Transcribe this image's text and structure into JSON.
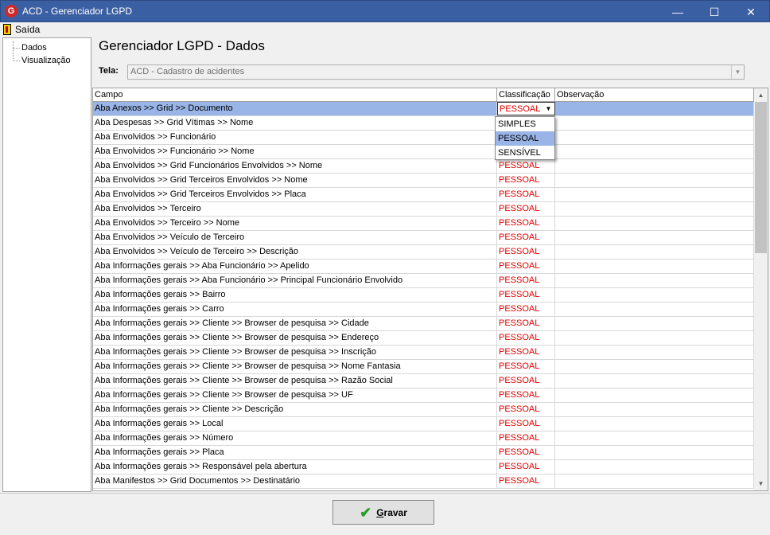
{
  "window": {
    "title": "ACD - Gerenciador LGPD",
    "app_icon_letter": "G",
    "minimize_glyph": "—",
    "maximize_glyph": "☐",
    "close_glyph": "✕"
  },
  "menu": {
    "exit_label": "Saída",
    "exit_icon": "exit-door-icon"
  },
  "tree": {
    "items": [
      "Dados",
      "Visualização"
    ]
  },
  "heading": "Gerenciador LGPD - Dados",
  "tela": {
    "label": "Tela:",
    "value": "ACD - Cadastro de acidentes"
  },
  "grid": {
    "columns": [
      "Campo",
      "Classificação",
      "Observação"
    ],
    "selected_row_index": 0,
    "rows": [
      {
        "campo": "Aba Anexos >> Grid >> Documento",
        "classificacao": "PESSOAL",
        "observacao": ""
      },
      {
        "campo": "Aba Despesas >> Grid Vítimas >> Nome",
        "classificacao": "",
        "observacao": ""
      },
      {
        "campo": "Aba Envolvidos >> Funcionário",
        "classificacao": "",
        "observacao": ""
      },
      {
        "campo": "Aba Envolvidos >> Funcionário >> Nome",
        "classificacao": "",
        "observacao": ""
      },
      {
        "campo": "Aba Envolvidos >> Grid Funcionários Envolvidos >> Nome",
        "classificacao": "PESSOAL",
        "observacao": ""
      },
      {
        "campo": "Aba Envolvidos >> Grid Terceiros Envolvidos >> Nome",
        "classificacao": "PESSOAL",
        "observacao": ""
      },
      {
        "campo": "Aba Envolvidos >> Grid Terceiros Envolvidos >> Placa",
        "classificacao": "PESSOAL",
        "observacao": ""
      },
      {
        "campo": "Aba Envolvidos >> Terceiro",
        "classificacao": "PESSOAL",
        "observacao": ""
      },
      {
        "campo": "Aba Envolvidos >> Terceiro >> Nome",
        "classificacao": "PESSOAL",
        "observacao": ""
      },
      {
        "campo": "Aba Envolvidos >> Veículo de Terceiro",
        "classificacao": "PESSOAL",
        "observacao": ""
      },
      {
        "campo": "Aba Envolvidos >> Veículo de Terceiro >> Descrição",
        "classificacao": "PESSOAL",
        "observacao": ""
      },
      {
        "campo": "Aba Informações gerais >> Aba Funcionário >> Apelido",
        "classificacao": "PESSOAL",
        "observacao": ""
      },
      {
        "campo": "Aba Informações gerais >> Aba Funcionário >> Principal Funcionário Envolvido",
        "classificacao": "PESSOAL",
        "observacao": ""
      },
      {
        "campo": "Aba Informações gerais >> Bairro",
        "classificacao": "PESSOAL",
        "observacao": ""
      },
      {
        "campo": "Aba Informações gerais >> Carro",
        "classificacao": "PESSOAL",
        "observacao": ""
      },
      {
        "campo": "Aba Informações gerais >> Cliente >> Browser de pesquisa >> Cidade",
        "classificacao": "PESSOAL",
        "observacao": ""
      },
      {
        "campo": "Aba Informações gerais >> Cliente >> Browser de pesquisa >> Endereço",
        "classificacao": "PESSOAL",
        "observacao": ""
      },
      {
        "campo": "Aba Informações gerais >> Cliente >> Browser de pesquisa >> Inscrição",
        "classificacao": "PESSOAL",
        "observacao": ""
      },
      {
        "campo": "Aba Informações gerais >> Cliente >> Browser de pesquisa >> Nome Fantasia",
        "classificacao": "PESSOAL",
        "observacao": ""
      },
      {
        "campo": "Aba Informações gerais >> Cliente >> Browser de pesquisa >> Razão Social",
        "classificacao": "PESSOAL",
        "observacao": ""
      },
      {
        "campo": "Aba Informações gerais >> Cliente >> Browser de pesquisa >> UF",
        "classificacao": "PESSOAL",
        "observacao": ""
      },
      {
        "campo": "Aba Informações gerais >> Cliente >> Descrição",
        "classificacao": "PESSOAL",
        "observacao": ""
      },
      {
        "campo": "Aba Informações gerais >> Local",
        "classificacao": "PESSOAL",
        "observacao": ""
      },
      {
        "campo": "Aba Informações gerais >> Número",
        "classificacao": "PESSOAL",
        "observacao": ""
      },
      {
        "campo": "Aba Informações gerais >> Placa",
        "classificacao": "PESSOAL",
        "observacao": ""
      },
      {
        "campo": "Aba Informações gerais >> Responsável pela abertura",
        "classificacao": "PESSOAL",
        "observacao": ""
      },
      {
        "campo": "Aba Manifestos >> Grid Documentos >> Destinatário",
        "classificacao": "PESSOAL",
        "observacao": ""
      }
    ]
  },
  "dropdown": {
    "options": [
      "SIMPLES",
      "PESSOAL",
      "SENSÍVEL"
    ],
    "highlighted_index": 1
  },
  "footer": {
    "save_underlined": "G",
    "save_rest": "ravar",
    "save_icon": "checkmark-icon"
  },
  "colors": {
    "classification_text": "#e00000",
    "selection": "#99b4e6",
    "titlebar": "#3b5fa3"
  }
}
